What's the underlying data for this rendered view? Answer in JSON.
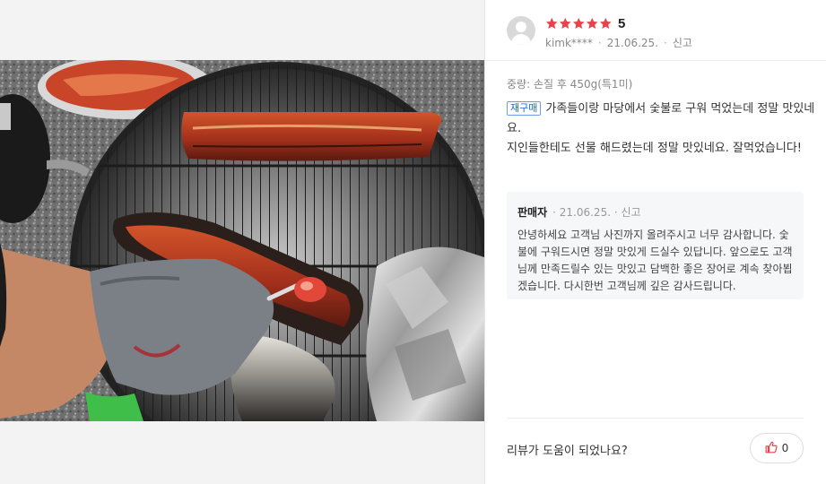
{
  "review": {
    "rating": "5",
    "stars_filled": 5,
    "star_color": "#e8434b",
    "user": "kimk****",
    "date": "21.06.25.",
    "report_label": "신고",
    "option": "중량: 손질 후 450g(특1미)",
    "badge": "재구매",
    "content_line1": "가족들이랑 마당에서 숯불로 구워 먹었는데 정말 맛있네요.",
    "content_line2": "지인들한테도 선물 해드렸는데 정말 맛있네요. 잘먹었습니다!"
  },
  "reply": {
    "seller_label": "판매자",
    "date": "21.06.25.",
    "report_label": "신고",
    "text": "안녕하세요 고객님 사진까지 올려주시고 너무 감사합니다. 숯불에 구워드시면 정말 맛있게 드실수 있답니다. 앞으로도 고객님께 만족드릴수 있는 맛있고 담백한 좋은 장어로 계속 찾아뵙겠습니다. 다시한번 고객님께 깊은 감사드립니다."
  },
  "footer": {
    "helpful_question": "리뷰가 도움이 되었나요?",
    "like_count": "0",
    "like_icon": "thumbs-up-icon",
    "like_color": "#e8434b"
  }
}
